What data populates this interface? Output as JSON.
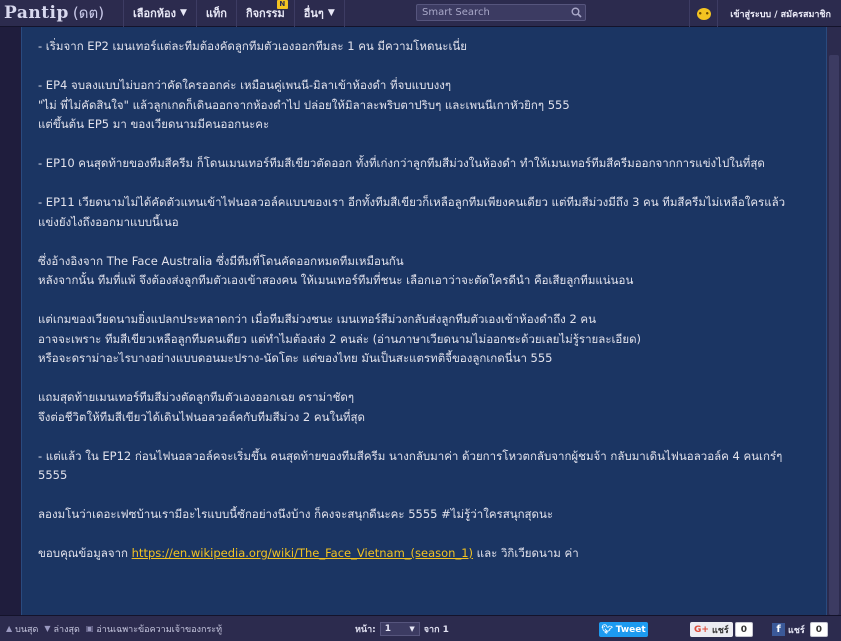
{
  "header": {
    "logo_text": "Pantip",
    "logo_mark": "(ดต)",
    "nav": [
      {
        "label": "เลือกห้อง",
        "caret": "▼"
      },
      {
        "label": "แท็ก",
        "caret": ""
      },
      {
        "label": "กิจกรรม",
        "caret": "",
        "badge": "N"
      },
      {
        "label": "อื่นๆ",
        "caret": "▼"
      }
    ],
    "search_placeholder": "Smart Search",
    "login_label": "เข้าสู่ระบบ / สมัครสมาชิก"
  },
  "post": {
    "paragraphs": [
      [
        "- เริ่มจาก EP2 เมนเทอร์แต่ละทีมต้องคัดลูกทีมตัวเองออกทีมละ 1 คน มีความโหดนะเนี่ย"
      ],
      [
        "- EP4 จบลงแบบไม่บอกว่าคัดใครออกค่ะ เหมือนคู่เพนนี-มิลาเข้าห้องดำ ที่จบแบบงงๆ",
        "\"ไม่ พี่ไม่คัดสินใจ\" แล้วลูกเกดก็เดินออกจากห้องดำไป ปล่อยให้มิลาละพริบตาปริบๆ และเพนนีเกาหัวยิกๆ 555",
        "แต่ขึ้นต้น EP5 มา ของเวียดนามมีคนออกนะคะ"
      ],
      [
        "- EP10 คนสุดท้ายของทีมสีครีม ก็โดนเมนเทอร์ทีมสีเขียวตัดออก ทั้งที่เก่งกว่าลูกทีมสีม่วงในห้องดำ ทำให้เมนเทอร์ทีมสีครีมออกจากการแข่งไปในที่สุด"
      ],
      [
        "- EP11 เวียดนามไม่ได้คัดตัวแทนเข้าไฟนอลวอล์คแบบของเรา อีกทั้งทีมสีเขียวก็เหลือลูกทีมเพียงคนเดียว แต่ทีมสีม่วงมีถึง 3 คน ทีมสีครีมไม่เหลือใครแล้ว แข่งยังไงถึงออกมาแบบนี้เนอ"
      ],
      [
        "ซึ่งอ้างอิงจาก The Face Australia ซึ่งมีทีมที่โดนคัดออกหมดทีมเหมือนกัน",
        "หลังจากนั้น ทีมที่แพ้ จึงต้องส่งลูกทีมตัวเองเข้าสองคน ให้เมนเทอร์ทีมที่ชนะ เลือกเอาว่าจะตัดใครดีนำ คือเสียลูกทีมแน่นอน"
      ],
      [
        "แต่เกมของเวียดนามยิ่งแปลกประหลาดกว่า เมื่อทีมสีม่วงชนะ เมนเทอร์สีม่วงกลับส่งลูกทีมตัวเองเข้าห้องดำถึง 2 คน",
        "อาจจะเพราะ ทีมสีเขียวเหลือลูกทีมคนเดียว แต่ทำไมต้องส่ง 2 คนล่ะ (อ่านภาษาเวียดนามไม่ออกชะด้วยเลยไม่รู้รายละเอียด)",
        "หรือจะดราม่าอะไรบางอย่างแบบดอนมะปราง-นัดโตะ แต่ของไทย มันเป็นสะแตรทติจี้ของลูกเกดนี่นา 555"
      ],
      [
        "แถมสุดท้ายเมนเทอร์ทีมสีม่วงตัดลูกทีมตัวเองออกเฉย ดราม่าชัดๆ",
        "จึงต่อชีวิตให้ทีมสีเขียวได้เดินไฟนอลวอล์คกับทีมสีม่วง 2 คนในที่สุด"
      ],
      [
        "- แต่แล้ว ใน EP12 ก่อนไฟนอลวอล์คจะเริ่มขึ้น คนสุดท้ายของทีมสีครีม นางกลับมาค่า ด้วยการโหวตกลับจากผู้ชมจ้า กลับมาเดินไฟนอลวอล์ค 4 คนเกร๋ๆ 5555"
      ],
      [
        "ลองมโนว่าเดอะเฟซบ้านเรามีอะไรแบบนี้ซักอย่างนึงบ้าง ก็คงจะสนุกดีนะคะ 5555 #ไม่รู้ว่าใครสนุกสุดนะ"
      ]
    ],
    "credit": {
      "prefix": "ขอบคุณข้อมูลจาก ",
      "link": "https://en.wikipedia.org/wiki/The_Face_Vietnam_(season_1)",
      "suffix": " และ วิกิเวียดนาม ค่า"
    }
  },
  "footer": {
    "top_label": "บนสุด",
    "bottom_label": "ล่างสุด",
    "owner_only_label": "อ่านเฉพาะข้อความเจ้าของกระทู้",
    "page_label": "หน้า:",
    "page_value": "1",
    "page_of": "จาก 1",
    "tweet_label": "Tweet",
    "gplus_label": "แชร์",
    "gplus_count": "0",
    "fb_label": "แชร์",
    "fb_count": "0"
  },
  "colors": {
    "accent": "#f3c321",
    "nav_bg": "#2c2b4e",
    "content_bg": "#1b3563",
    "twitter": "#1d9bf0",
    "facebook": "#3b5998"
  },
  "icons": [
    "search-icon",
    "emoticon-icon",
    "arrow-up-icon",
    "arrow-down-icon",
    "owner-icon",
    "twitter-bird-icon",
    "google-plus-icon",
    "facebook-icon"
  ]
}
